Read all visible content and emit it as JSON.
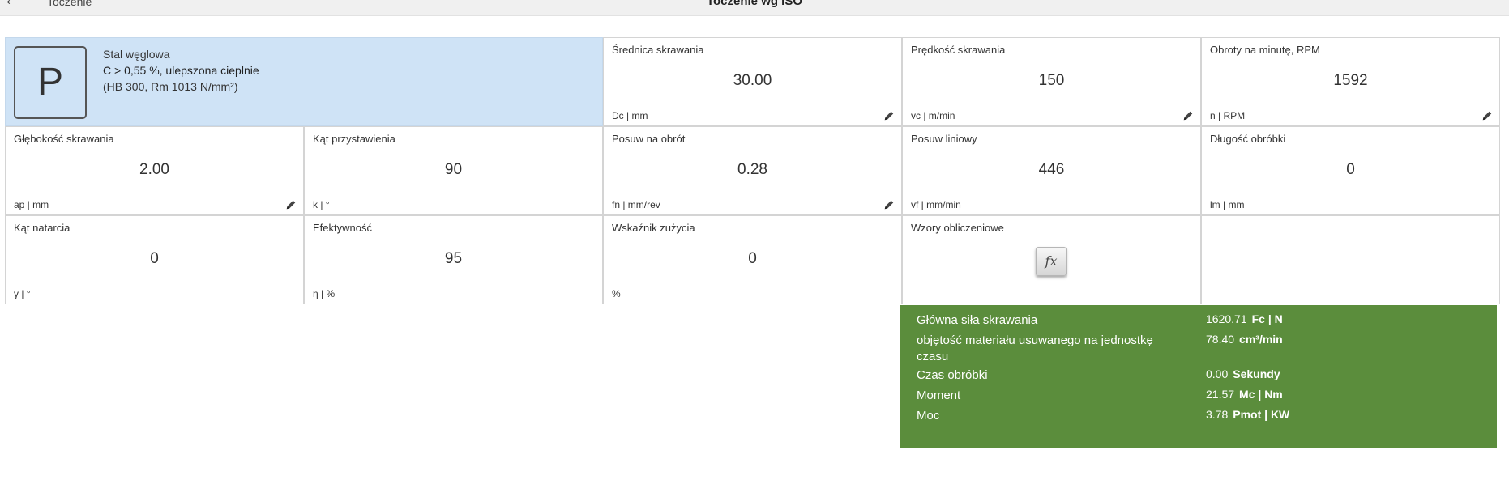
{
  "header": {
    "back_icon": "arrow-left-icon",
    "breadcrumb": "Toczenie",
    "title": "Toczenie wg ISO"
  },
  "material": {
    "group": "P",
    "name": "Stal węglowa",
    "description": "C > 0,55 %, ulepszona cieplnie",
    "hardness": "(HB 300, Rm 1013 N/mm²)",
    "color": "#cfe3f6"
  },
  "params": {
    "dc": {
      "label": "Średnica skrawania",
      "value": "30.00",
      "unit": "Dc | mm"
    },
    "vc": {
      "label": "Prędkość skrawania",
      "value": "150",
      "unit": "vc | m/min"
    },
    "n": {
      "label": "Obroty na minutę, RPM",
      "value": "1592",
      "unit": "n | RPM"
    },
    "ap": {
      "label": "Głębokość skrawania",
      "value": "2.00",
      "unit": "ap | mm"
    },
    "kappa": {
      "label": "Kąt przystawienia",
      "value": "90",
      "unit": "k | °"
    },
    "fn": {
      "label": "Posuw na obrót",
      "value": "0.28",
      "unit": "fn | mm/rev"
    },
    "vf": {
      "label": "Posuw liniowy",
      "value": "446",
      "unit": "vf | mm/min"
    },
    "lm": {
      "label": "Długość obróbki",
      "value": "0",
      "unit": "lm | mm"
    },
    "gamma": {
      "label": "Kąt natarcia",
      "value": "0",
      "unit": "γ | °"
    },
    "eta": {
      "label": "Efektywność",
      "value": "95",
      "unit": "η | %"
    },
    "wear": {
      "label": "Wskaźnik zużycia",
      "value": "0",
      "unit": "%"
    },
    "formulas": {
      "label": "Wzory obliczeniowe",
      "button": "fx"
    }
  },
  "results": {
    "color": "#5b8d3c",
    "items": [
      {
        "label": "Główna siła skrawania",
        "value": "1620.71",
        "unit": "Fc | N"
      },
      {
        "label": "objętość materiału usuwanego na jednostkę czasu",
        "value": "78.40",
        "unit": "cm³/min"
      },
      {
        "label": "Czas obróbki",
        "value": "0.00",
        "unit": "Sekundy"
      },
      {
        "label": "Moment",
        "value": "21.57",
        "unit": "Mc | Nm"
      },
      {
        "label": "Moc",
        "value": "3.78",
        "unit": "Pmot | KW"
      }
    ]
  }
}
